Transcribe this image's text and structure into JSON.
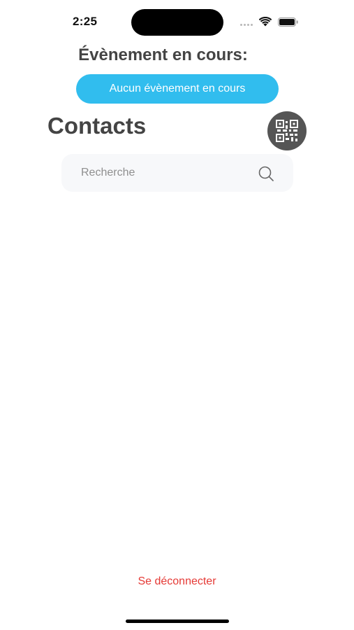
{
  "status_bar": {
    "time": "2:25",
    "icons": [
      "cellular-signal-icon",
      "wifi-icon",
      "battery-icon"
    ]
  },
  "event": {
    "heading": "Évènement en cours:",
    "button_label": "Aucun évènement en cours",
    "button_color": "#31bdee"
  },
  "contacts": {
    "title": "Contacts",
    "qr_button_icon": "qr-code-icon"
  },
  "search": {
    "placeholder": "Recherche",
    "value": "",
    "icon": "search-icon"
  },
  "footer": {
    "logout_label": "Se déconnecter",
    "logout_color": "#e53935"
  }
}
